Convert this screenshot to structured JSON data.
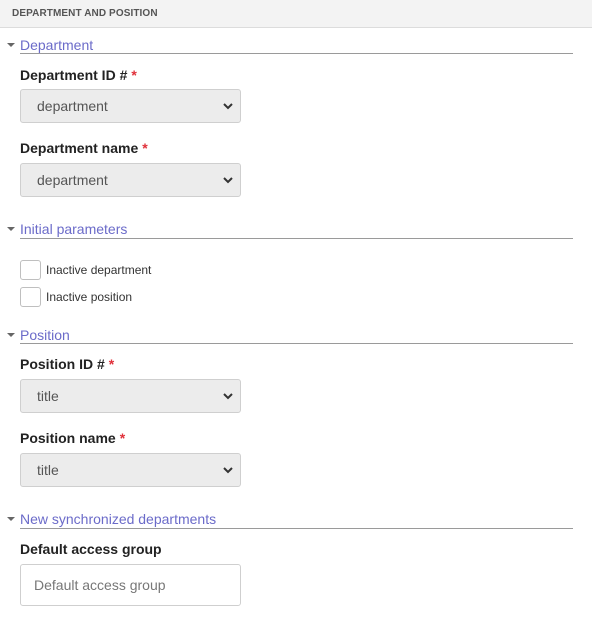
{
  "panel": {
    "title": "DEPARTMENT AND POSITION"
  },
  "sections": {
    "department": {
      "title": "Department",
      "fields": {
        "id": {
          "label": "Department ID #",
          "required_mark": "*",
          "value": "department"
        },
        "name": {
          "label": "Department name",
          "required_mark": "*",
          "value": "department"
        }
      }
    },
    "initial": {
      "title": "Initial parameters",
      "checkboxes": [
        {
          "label": "Inactive department",
          "checked": false
        },
        {
          "label": "Inactive position",
          "checked": false
        }
      ]
    },
    "position": {
      "title": "Position",
      "fields": {
        "id": {
          "label": "Position ID #",
          "required_mark": "*",
          "value": "title"
        },
        "name": {
          "label": "Position name",
          "required_mark": "*",
          "value": "title"
        }
      }
    },
    "sync": {
      "title": "New synchronized departments",
      "fields": {
        "access_group": {
          "label": "Default access group",
          "value": "",
          "placeholder": "Default access group"
        }
      }
    }
  },
  "colors": {
    "accent": "#6b6bc9",
    "required": "#e0303a"
  }
}
